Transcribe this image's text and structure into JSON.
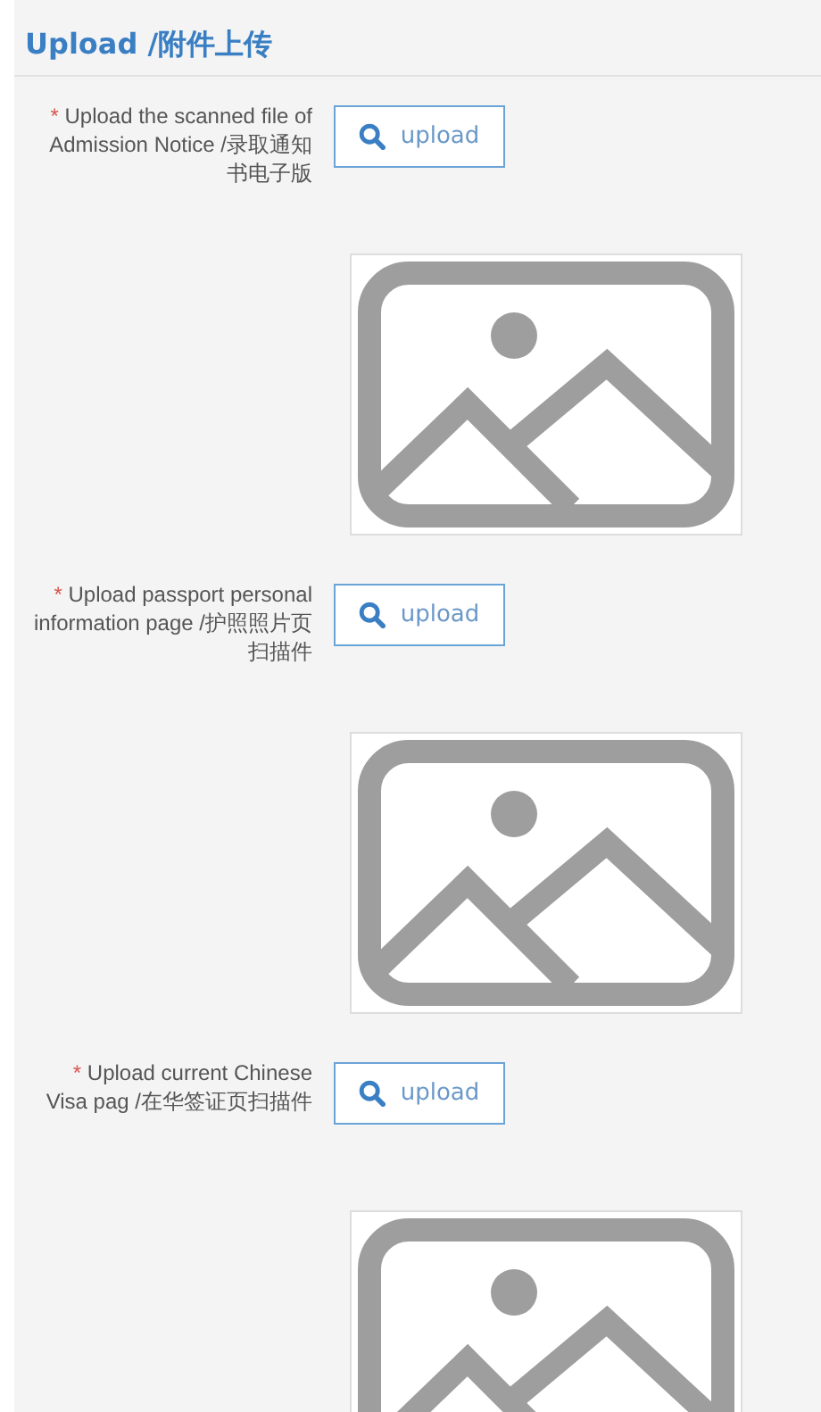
{
  "section": {
    "title": "Upload /附件上传"
  },
  "fields": [
    {
      "required_mark": "*",
      "label": "Upload the scanned file of Admission Notice /录取通知书电子版",
      "button": "upload"
    },
    {
      "required_mark": "*",
      "label": "Upload passport personal information page /护照照片页扫描件",
      "button": "upload"
    },
    {
      "required_mark": "*",
      "label": "Upload current Chinese Visa pag /在华签证页扫描件",
      "button": "upload"
    }
  ]
}
